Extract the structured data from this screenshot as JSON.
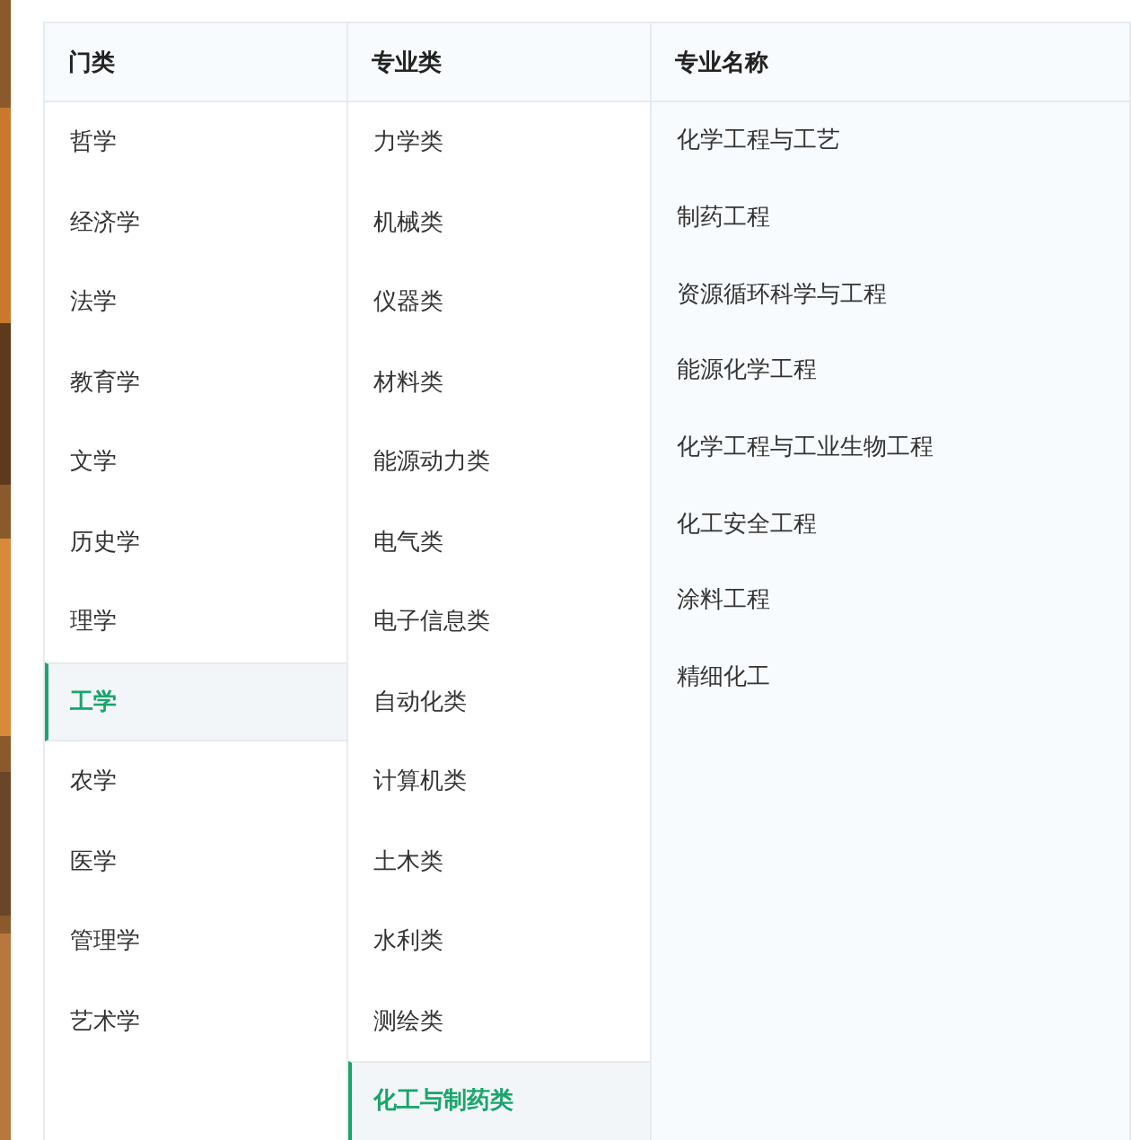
{
  "categories": {
    "heading": "门类",
    "items": [
      {
        "label": "哲学",
        "selected": false
      },
      {
        "label": "经济学",
        "selected": false
      },
      {
        "label": "法学",
        "selected": false
      },
      {
        "label": "教育学",
        "selected": false
      },
      {
        "label": "文学",
        "selected": false
      },
      {
        "label": "历史学",
        "selected": false
      },
      {
        "label": "理学",
        "selected": false
      },
      {
        "label": "工学",
        "selected": true
      },
      {
        "label": "农学",
        "selected": false
      },
      {
        "label": "医学",
        "selected": false
      },
      {
        "label": "管理学",
        "selected": false
      },
      {
        "label": "艺术学",
        "selected": false
      }
    ]
  },
  "subjects": {
    "heading": "专业类",
    "items": [
      {
        "label": "力学类",
        "selected": false
      },
      {
        "label": "机械类",
        "selected": false
      },
      {
        "label": "仪器类",
        "selected": false
      },
      {
        "label": "材料类",
        "selected": false
      },
      {
        "label": "能源动力类",
        "selected": false
      },
      {
        "label": "电气类",
        "selected": false
      },
      {
        "label": "电子信息类",
        "selected": false
      },
      {
        "label": "自动化类",
        "selected": false
      },
      {
        "label": "计算机类",
        "selected": false
      },
      {
        "label": "土木类",
        "selected": false
      },
      {
        "label": "水利类",
        "selected": false
      },
      {
        "label": "测绘类",
        "selected": false
      },
      {
        "label": "化工与制药类",
        "selected": true
      }
    ]
  },
  "majors": {
    "heading": "专业名称",
    "items": [
      "化学工程与工艺",
      "制药工程",
      "资源循环科学与工程",
      "能源化学工程",
      "化学工程与工业生物工程",
      "化工安全工程",
      "涂料工程",
      "精细化工"
    ]
  }
}
